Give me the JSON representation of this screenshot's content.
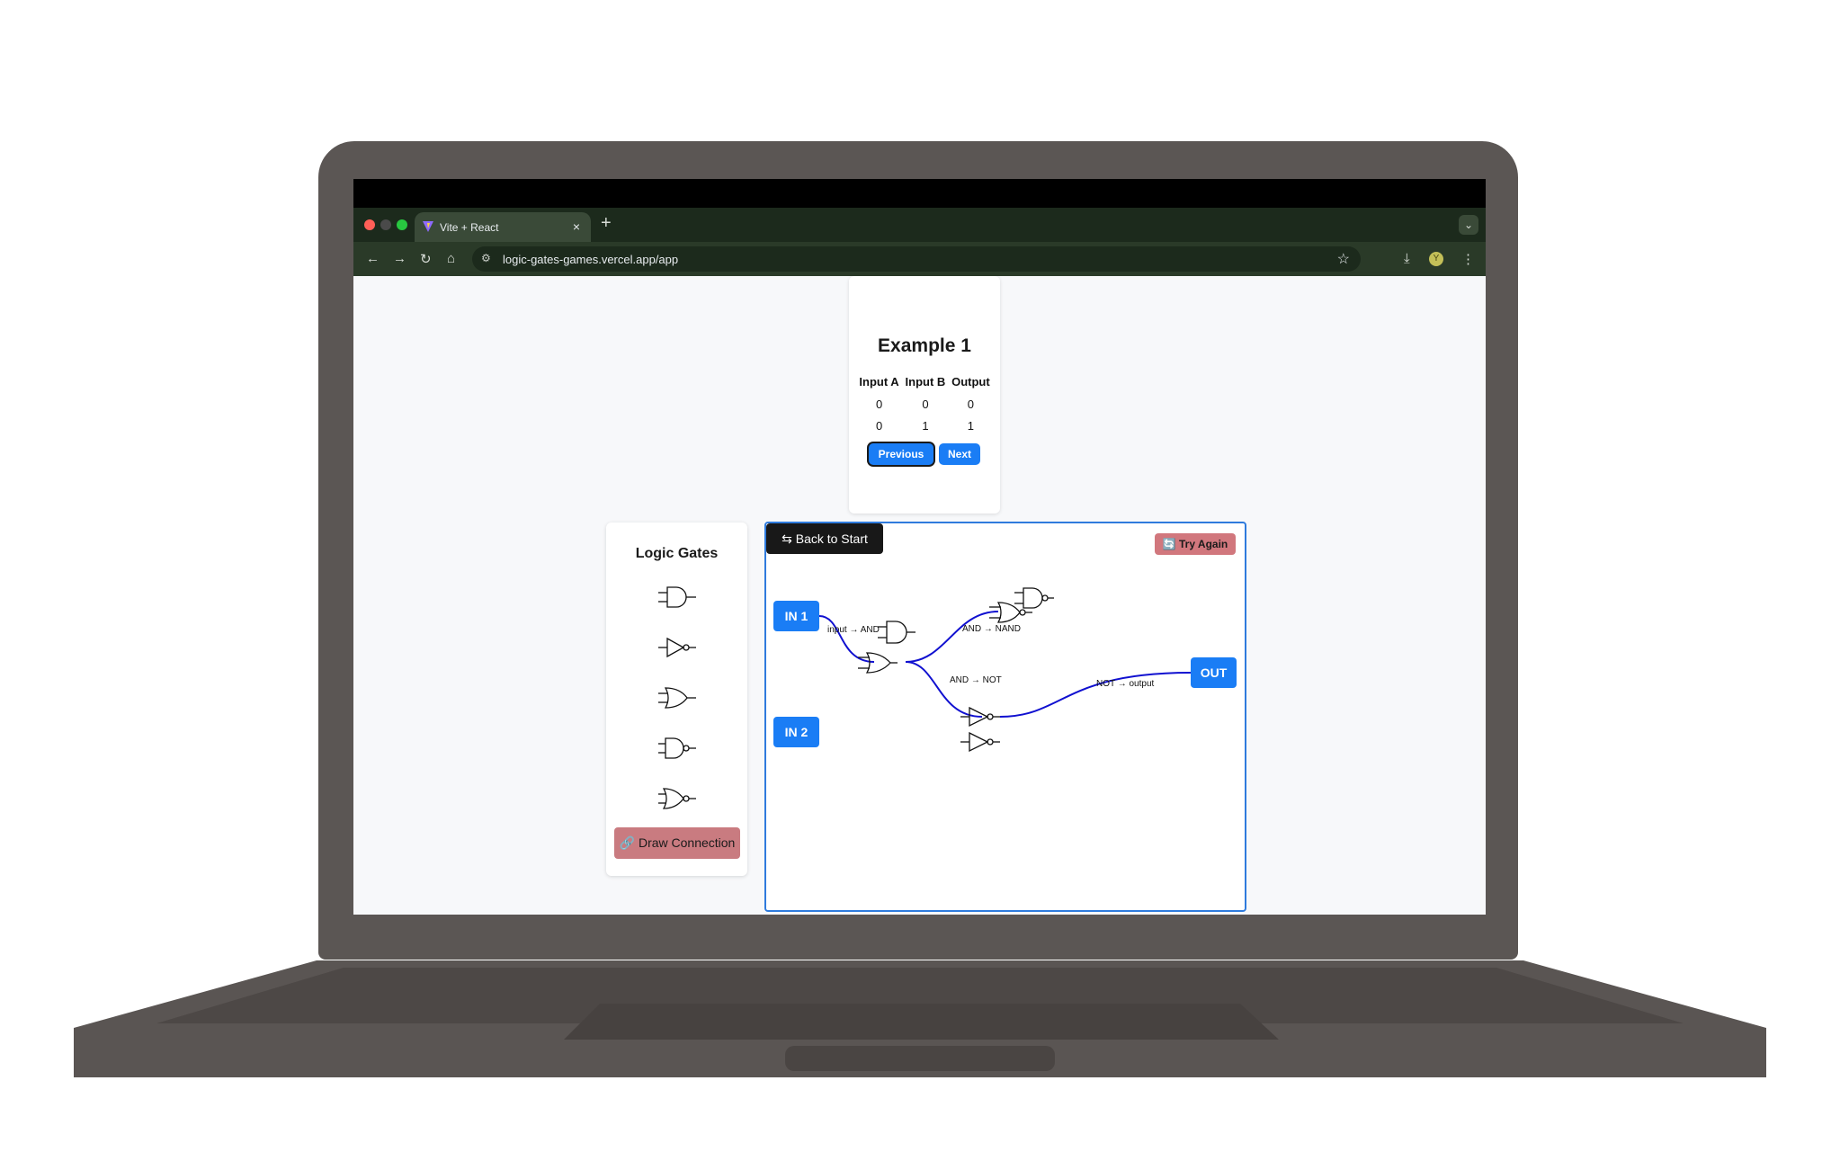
{
  "browser": {
    "tab_title": "Vite + React",
    "tab_close": "×",
    "new_tab": "+",
    "tab_menu": "⌄",
    "url": "logic-gates-games.vercel.app/app",
    "nav": {
      "back": "←",
      "forward": "→",
      "reload": "↻",
      "home": "⌂",
      "star": "☆",
      "download": "⤓",
      "menu": "⋮",
      "avatar": "Y"
    }
  },
  "example": {
    "title": "Example 1",
    "headers": [
      "Input A",
      "Input B",
      "Output"
    ],
    "rows": [
      [
        "0",
        "0",
        "0"
      ],
      [
        "0",
        "1",
        "1"
      ]
    ],
    "previous_label": "Previous",
    "next_label": "Next"
  },
  "gates_panel": {
    "title": "Logic Gates",
    "gates": [
      {
        "type": "AND",
        "icon": "and-gate-icon"
      },
      {
        "type": "NOT",
        "icon": "not-gate-icon"
      },
      {
        "type": "OR",
        "icon": "or-gate-icon"
      },
      {
        "type": "NAND",
        "icon": "nand-gate-icon"
      },
      {
        "type": "NOR",
        "icon": "nor-gate-icon"
      }
    ],
    "draw_connection_label": "🔗 Draw Connection"
  },
  "canvas": {
    "back_label": "⇆ Back to Start",
    "try_again_label": "🔄 Try Again",
    "inputs": [
      "IN 1",
      "IN 2"
    ],
    "output": "OUT",
    "wire_labels": [
      "input → AND",
      "AND → NAND",
      "AND → NOT",
      "NOT → output"
    ]
  },
  "colors": {
    "accent": "#1a7df5",
    "wire": "#1010d0",
    "danger": "#c97b80",
    "canvas_border": "#2f7bdd"
  }
}
